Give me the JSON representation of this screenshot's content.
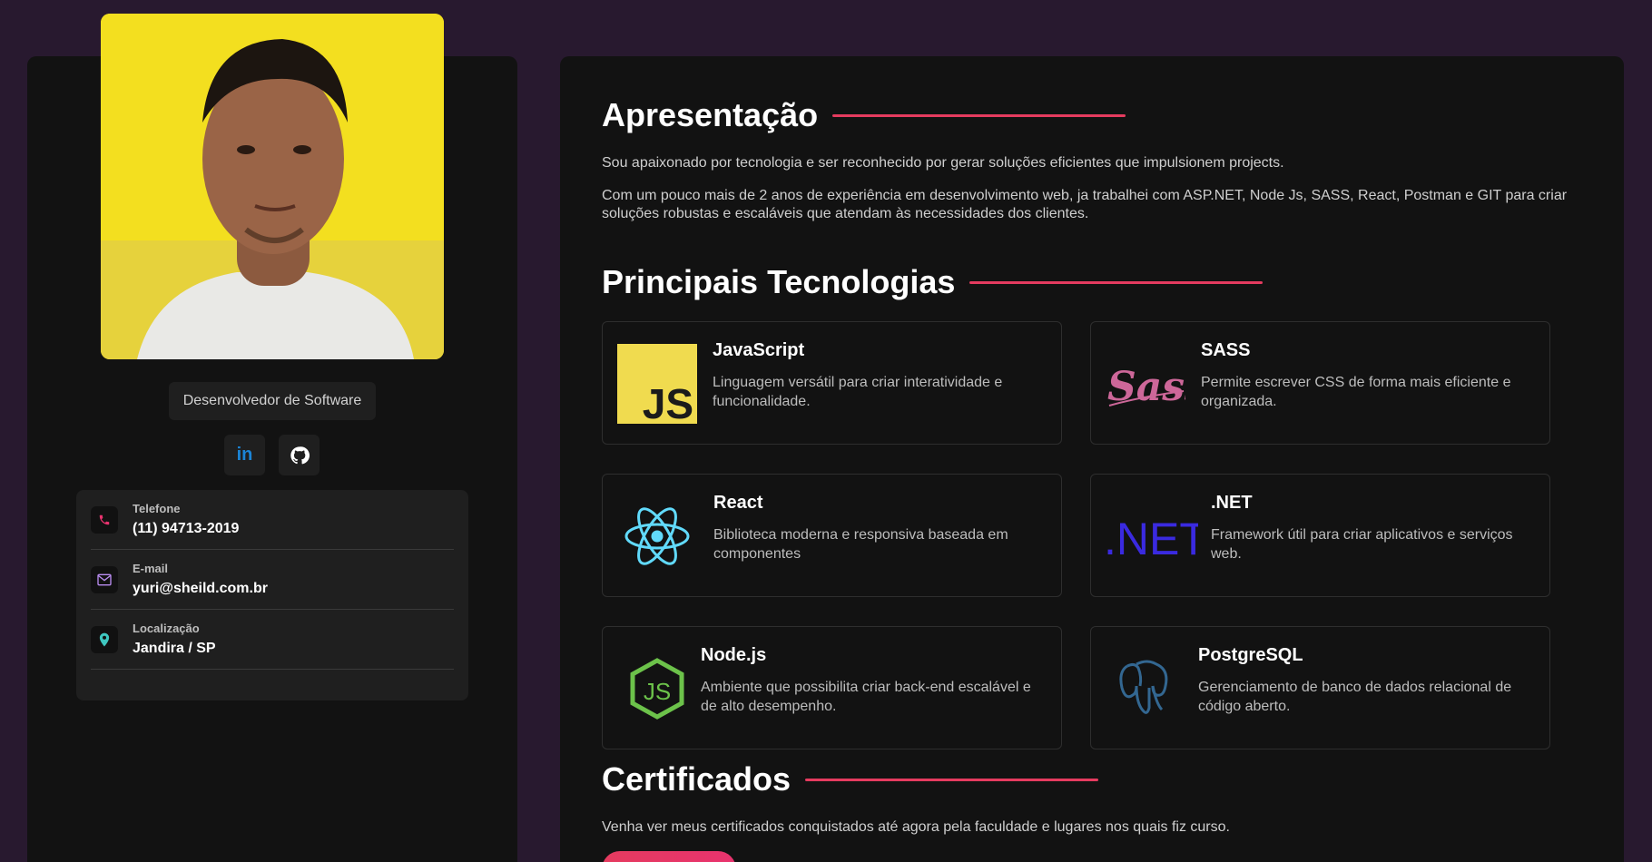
{
  "profile": {
    "role": "Desenvolvedor de Software",
    "social": [
      {
        "name": "linkedin",
        "label": "in"
      },
      {
        "name": "github",
        "label": ""
      }
    ],
    "contacts": [
      {
        "label": "Telefone",
        "value": "(11) 94713-2019",
        "icon": "phone-icon",
        "color": "#e8336e"
      },
      {
        "label": "E-mail",
        "value": "yuri@sheild.com.br",
        "icon": "mail-icon",
        "color": "#b98cf0"
      },
      {
        "label": "Localização",
        "value": "Jandira / SP",
        "icon": "location-icon",
        "color": "#3fc7c0"
      }
    ]
  },
  "sections": {
    "about": {
      "title": "Apresentação",
      "paragraphs": [
        "Sou apaixonado por tecnologia e ser reconhecido por gerar soluções eficientes que impulsionem projects.",
        "Com um pouco mais de 2 anos de experiência em desenvolvimento web, ja trabalhei com ASP.NET, Node Js, SASS, React, Postman e GIT para criar soluções robustas e escaláveis que atendam às necessidades dos clientes."
      ]
    },
    "tech": {
      "title": "Principais Tecnologias",
      "cards": [
        {
          "name": "JavaScript",
          "desc": "Linguagem versátil para criar interatividade e funcionalidade.",
          "icon": "javascript-icon"
        },
        {
          "name": "SASS",
          "desc": "Permite escrever CSS de forma mais eficiente e organizada.",
          "icon": "sass-icon"
        },
        {
          "name": "React",
          "desc": "Biblioteca moderna e responsiva baseada em componentes",
          "icon": "react-icon"
        },
        {
          "name": ".NET",
          "desc": "Framework útil para criar aplicativos e serviços web.",
          "icon": "dotnet-icon"
        },
        {
          "name": "Node.js",
          "desc": "Ambiente que possibilita criar back-end escalável e de alto desempenho.",
          "icon": "nodejs-icon"
        },
        {
          "name": "PostgreSQL",
          "desc": "Gerenciamento de banco de dados relacional de código aberto.",
          "icon": "postgresql-icon"
        }
      ]
    },
    "certificates": {
      "title": "Certificados",
      "text": "Venha ver meus certificados conquistados até agora pela faculdade e lugares nos quais fiz curso."
    }
  },
  "colors": {
    "background": "#28192f",
    "panel": "#121212",
    "accent": "#e53b5f"
  }
}
